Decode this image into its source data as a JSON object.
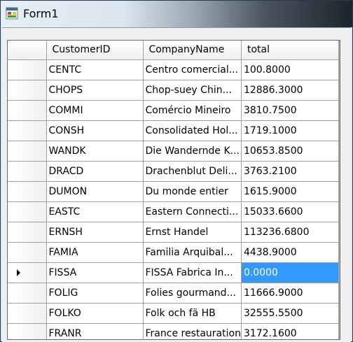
{
  "window": {
    "title": "Form1"
  },
  "grid": {
    "columns": [
      "CustomerID",
      "CompanyName",
      "total"
    ],
    "current_row": 10,
    "selected_cell": {
      "row": 10,
      "column": 2
    },
    "rows": [
      [
        "CENTC",
        "Centro comercial...",
        "100.8000"
      ],
      [
        "CHOPS",
        "Chop-suey Chin...",
        "12886.3000"
      ],
      [
        "COMMI",
        "Comércio Mineiro",
        "3810.7500"
      ],
      [
        "CONSH",
        "Consolidated Hol...",
        "1719.1000"
      ],
      [
        "WANDK",
        "Die Wandernde K...",
        "10653.8500"
      ],
      [
        "DRACD",
        "Drachenblut Deli...",
        "3763.2100"
      ],
      [
        "DUMON",
        "Du monde entier",
        "1615.9000"
      ],
      [
        "EASTC",
        "Eastern Connecti...",
        "15033.6600"
      ],
      [
        "ERNSH",
        "Ernst Handel",
        "113236.6800"
      ],
      [
        "FAMIA",
        "Familia Arquibal...",
        "4438.9000"
      ],
      [
        "FISSA",
        "FISSA Fabrica In...",
        "0.0000"
      ],
      [
        "FOLIG",
        "Folies gourmand...",
        "11666.9000"
      ],
      [
        "FOLKO",
        "Folk och fä HB",
        "32555.5500"
      ],
      [
        "FRANR",
        "France restauration",
        "3172.1600"
      ]
    ]
  },
  "colors": {
    "selection": "#3399ff",
    "grid_background": "#ababab"
  }
}
